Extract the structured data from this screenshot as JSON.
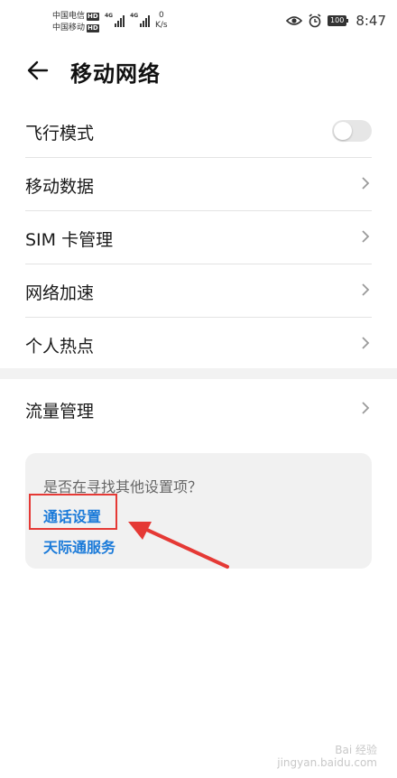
{
  "status_bar": {
    "carrier1": "中国电信",
    "carrier2": "中国移动",
    "hd_badge": "HD",
    "net_type1": "4G",
    "net_type2": "4G",
    "speed_value": "0",
    "speed_unit": "K/s",
    "battery": "100",
    "time": "8:47"
  },
  "header": {
    "title": "移动网络"
  },
  "settings": [
    {
      "label": "飞行模式",
      "type": "toggle",
      "on": false
    },
    {
      "label": "移动数据",
      "type": "link"
    },
    {
      "label": "SIM 卡管理",
      "type": "link"
    },
    {
      "label": "网络加速",
      "type": "link"
    },
    {
      "label": "个人热点",
      "type": "link"
    },
    {
      "label": "流量管理",
      "type": "link"
    }
  ],
  "suggestions": {
    "question": "是否在寻找其他设置项？",
    "links": [
      "通话设置",
      "天际通服务"
    ]
  },
  "colors": {
    "link": "#1a7ad9",
    "highlight": "#e53935"
  },
  "watermark": {
    "line1": "Bai 经验",
    "line2": "jingyan.baidu.com"
  }
}
